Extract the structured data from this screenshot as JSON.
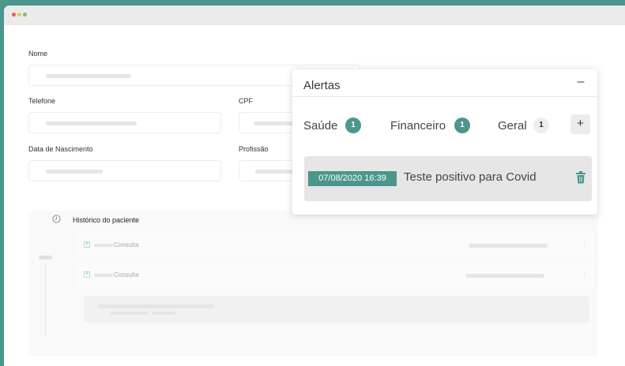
{
  "colors": {
    "accent": "#4b968d",
    "window_bg": "#ffffff",
    "titlebar_bg": "#ebebeb"
  },
  "form": {
    "nome_label": "Nome",
    "telefone_label": "Telefone",
    "cpf_label": "CPF",
    "nascimento_label": "Data de Nascimento",
    "profissao_label": "Profissão"
  },
  "history": {
    "icon": "clock-icon",
    "title": "Histórico do paciente",
    "entries": [
      {
        "label": "Consulta",
        "icon": "expand-plus-icon"
      },
      {
        "label": "Consulta",
        "icon": "expand-plus-icon"
      }
    ]
  },
  "alerts": {
    "title": "Alertas",
    "minimize_label": "–",
    "add_label": "+",
    "tabs": [
      {
        "label": "Saúde",
        "count": "1"
      },
      {
        "label": "Financeiro",
        "count": "1"
      },
      {
        "label": "Geral",
        "count": "1"
      }
    ],
    "items": [
      {
        "date": "07/08/2020 16:39",
        "text": "Teste positivo para Covid",
        "icon": "trash-icon"
      }
    ]
  }
}
